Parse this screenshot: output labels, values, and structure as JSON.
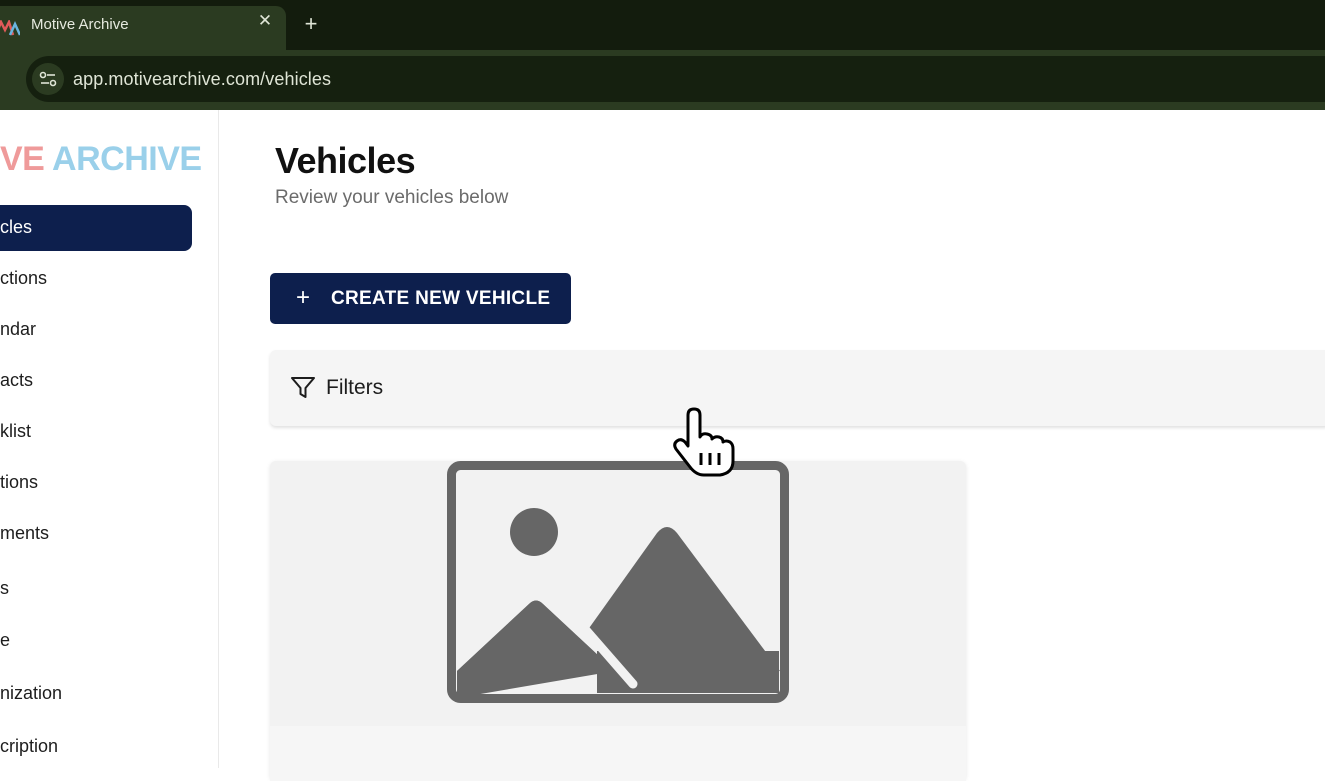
{
  "browser": {
    "tab_title": "Motive Archive",
    "tab_close_glyph": "✕",
    "new_tab_glyph": "+",
    "url": "app.motivearchive.com/vehicles",
    "icons": [
      "motive-archive-favicon",
      "close-icon",
      "plus-icon",
      "site-settings-icon"
    ]
  },
  "sidebar": {
    "logo_part_a": "VE",
    "logo_part_b": "ARCHIVE",
    "items": [
      {
        "label": "cles",
        "active": true
      },
      {
        "label": "ctions",
        "active": false
      },
      {
        "label": "ndar",
        "active": false
      },
      {
        "label": "acts",
        "active": false
      },
      {
        "label": "klist",
        "active": false
      },
      {
        "label": "tions",
        "active": false
      },
      {
        "label": "ments",
        "active": false
      },
      {
        "label": "s",
        "active": false
      },
      {
        "label": "e",
        "active": false
      },
      {
        "label": "nization",
        "active": false
      },
      {
        "label": "cription",
        "active": false
      }
    ]
  },
  "main": {
    "title": "Vehicles",
    "subtitle": "Review your vehicles below",
    "create_button": {
      "icon": "+",
      "label": "CREATE NEW VEHICLE"
    },
    "filters_label": "Filters",
    "card_image": "image-placeholder-icon"
  },
  "colors": {
    "navy": "#0d1f4d",
    "browser_dark": "#131c0d",
    "browser_tab": "#2b3b21",
    "placeholder_gray": "#666666"
  }
}
